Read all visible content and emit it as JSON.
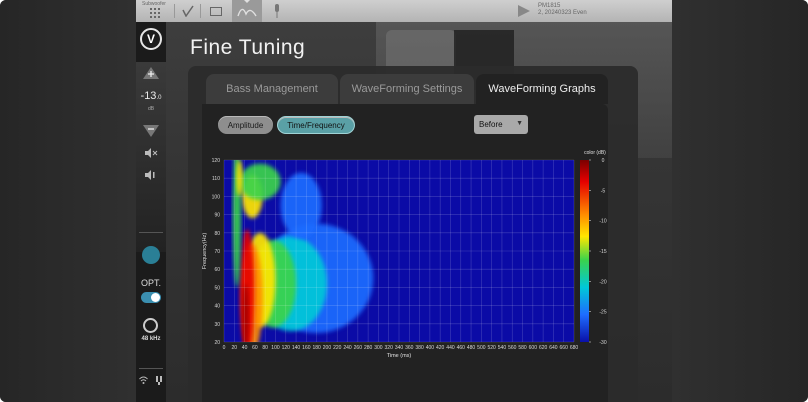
{
  "topbar": {
    "sub_label": "Subwoofer",
    "status_line1": "PM1815",
    "status_line2": "2, 20240323 Even"
  },
  "sidebar": {
    "volume_value": "-13",
    "volume_decimal": ".0",
    "volume_unit": "dB",
    "opt_label": "OPT.",
    "sample_rate": "48 kHz"
  },
  "page": {
    "title": "Fine Tuning"
  },
  "tabs": [
    {
      "label": "Bass Management",
      "active": false
    },
    {
      "label": "WaveForming Settings",
      "active": false
    },
    {
      "label": "WaveForming Graphs",
      "active": true
    }
  ],
  "view_buttons": [
    {
      "label": "Amplitude",
      "selected": false
    },
    {
      "label": "Time/Frequency",
      "selected": true
    }
  ],
  "view_select": {
    "value": "Before"
  },
  "chart_data": {
    "type": "heatmap",
    "xlabel": "Time (ms)",
    "ylabel": "Frequency(Hz)",
    "x_ticks": [
      0,
      20,
      40,
      60,
      80,
      100,
      120,
      140,
      160,
      180,
      200,
      220,
      240,
      260,
      280,
      300,
      320,
      340,
      360,
      380,
      400,
      420,
      440,
      460,
      480,
      500,
      520,
      540,
      560,
      580,
      600,
      620,
      640,
      660,
      680
    ],
    "y_ticks": [
      20,
      30,
      40,
      50,
      60,
      70,
      80,
      90,
      100,
      110,
      120
    ],
    "xlim": [
      0,
      680
    ],
    "ylim": [
      20,
      120
    ],
    "colorbar": {
      "title": "color (dB)",
      "ticks": [
        0,
        -5,
        -10,
        -15,
        -20,
        -25,
        -30
      ],
      "range": [
        -30,
        0
      ]
    },
    "grid": true
  }
}
